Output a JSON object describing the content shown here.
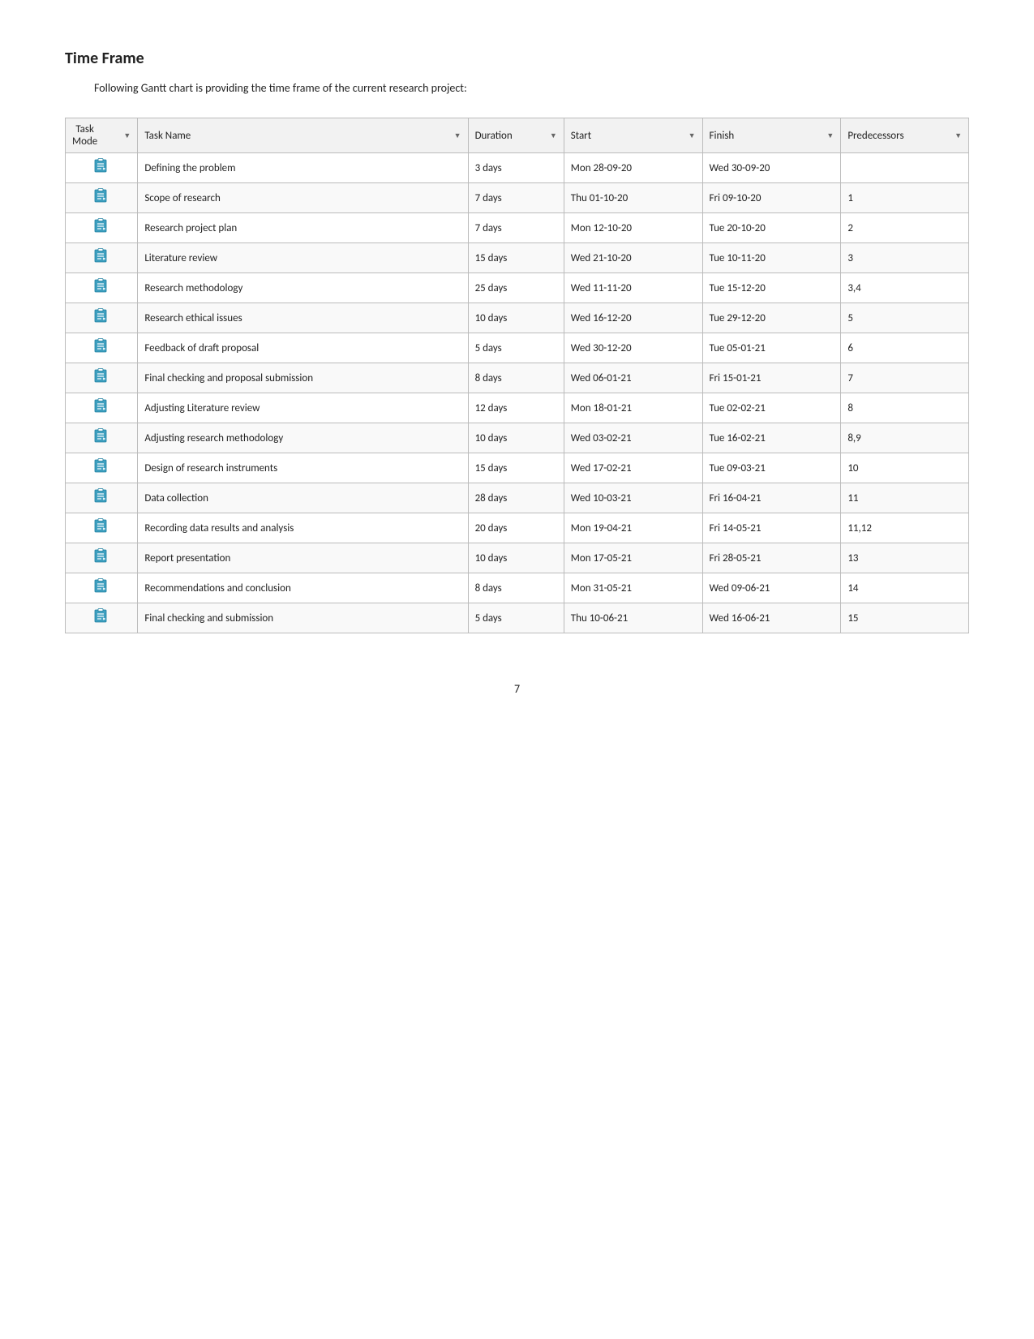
{
  "page": {
    "title": "Time Frame",
    "subtitle": "Following Gantt chart is providing the time frame of the current research project:",
    "page_number": "7"
  },
  "table": {
    "columns": [
      {
        "key": "mode",
        "label": "Task\nMode",
        "sortable": true
      },
      {
        "key": "name",
        "label": "Task Name",
        "sortable": true
      },
      {
        "key": "duration",
        "label": "Duration",
        "sortable": true
      },
      {
        "key": "start",
        "label": "Start",
        "sortable": true
      },
      {
        "key": "finish",
        "label": "Finish",
        "sortable": true
      },
      {
        "key": "predecessors",
        "label": "Predecessors",
        "sortable": true
      }
    ],
    "rows": [
      {
        "duration": "3 days",
        "name": "Defining the problem",
        "start": "Mon 28-09-20",
        "finish": "Wed 30-09-20",
        "predecessors": ""
      },
      {
        "duration": "7 days",
        "name": "Scope of research",
        "start": "Thu 01-10-20",
        "finish": "Fri 09-10-20",
        "predecessors": "1"
      },
      {
        "duration": "7 days",
        "name": "Research project plan",
        "start": "Mon 12-10-20",
        "finish": "Tue 20-10-20",
        "predecessors": "2"
      },
      {
        "duration": "15 days",
        "name": "Literature review",
        "start": "Wed 21-10-20",
        "finish": "Tue 10-11-20",
        "predecessors": "3"
      },
      {
        "duration": "25 days",
        "name": "Research methodology",
        "start": "Wed 11-11-20",
        "finish": "Tue 15-12-20",
        "predecessors": "3,4"
      },
      {
        "duration": "10 days",
        "name": "Research ethical issues",
        "start": "Wed 16-12-20",
        "finish": "Tue 29-12-20",
        "predecessors": "5"
      },
      {
        "duration": "5 days",
        "name": "Feedback of draft proposal",
        "start": "Wed 30-12-20",
        "finish": "Tue 05-01-21",
        "predecessors": "6"
      },
      {
        "duration": "8 days",
        "name": "Final checking and proposal submission",
        "start": "Wed 06-01-21",
        "finish": "Fri 15-01-21",
        "predecessors": "7"
      },
      {
        "duration": "12 days",
        "name": "Adjusting Literature review",
        "start": "Mon 18-01-21",
        "finish": "Tue 02-02-21",
        "predecessors": "8"
      },
      {
        "duration": "10 days",
        "name": "Adjusting research methodology",
        "start": "Wed 03-02-21",
        "finish": "Tue 16-02-21",
        "predecessors": "8,9"
      },
      {
        "duration": "15 days",
        "name": "Design of research instruments",
        "start": "Wed 17-02-21",
        "finish": "Tue 09-03-21",
        "predecessors": "10"
      },
      {
        "duration": "28 days",
        "name": "Data collection",
        "start": "Wed 10-03-21",
        "finish": "Fri 16-04-21",
        "predecessors": "11"
      },
      {
        "duration": "20 days",
        "name": "Recording data results and analysis",
        "start": "Mon 19-04-21",
        "finish": "Fri 14-05-21",
        "predecessors": "11,12"
      },
      {
        "duration": "10 days",
        "name": "Report presentation",
        "start": "Mon 17-05-21",
        "finish": "Fri 28-05-21",
        "predecessors": "13"
      },
      {
        "duration": "8 days",
        "name": "Recommendations and conclusion",
        "start": "Mon 31-05-21",
        "finish": "Wed 09-06-21",
        "predecessors": "14"
      },
      {
        "duration": "5 days",
        "name": "Final checking and submission",
        "start": "Thu 10-06-21",
        "finish": "Wed 16-06-21",
        "predecessors": "15"
      }
    ]
  }
}
